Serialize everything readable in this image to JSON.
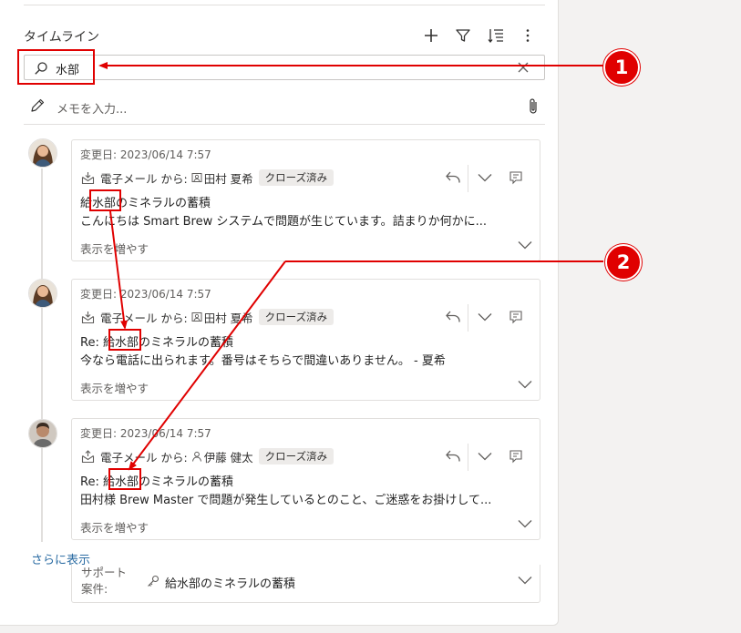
{
  "timeline": {
    "title": "タイムライン",
    "search_value": "水部",
    "memo_placeholder": "メモを入力..."
  },
  "posts": [
    {
      "date": "変更日: 2023/06/14 7:57",
      "type": "電子メール から:",
      "sender": "田村 夏希",
      "status": "クローズ済み",
      "subject": "給水部のミネラルの蓄積",
      "body": "こんにちは Smart Brew システムで問題が生じています。詰まりか何かに...",
      "more": "表示を増やす"
    },
    {
      "date": "変更日: 2023/06/14 7:57",
      "type": "電子メール から:",
      "sender": "田村 夏希",
      "status": "クローズ済み",
      "subject": "Re: 給水部のミネラルの蓄積",
      "body": "今なら電話に出られます。番号はそちらで間違いありません。 - 夏希",
      "more": "表示を増やす"
    },
    {
      "date": "変更日: 2023/06/14 7:57",
      "type": "電子メール から:",
      "sender": "伊藤 健太",
      "status": "クローズ済み",
      "subject": "Re: 給水部のミネラルの蓄積",
      "body": "田村様 Brew Master で問題が発生しているとのこと、ご迷惑をお掛けして...",
      "more": "表示を増やす"
    }
  ],
  "show_more_link": "さらに表示",
  "case": {
    "label": "サポート 案件:",
    "title": "給水部のミネラルの蓄積"
  },
  "callouts": [
    "1",
    "2"
  ],
  "colors": {
    "highlight": "#e00000",
    "link": "#2b6ca3",
    "badge_bg": "#edebe9"
  }
}
